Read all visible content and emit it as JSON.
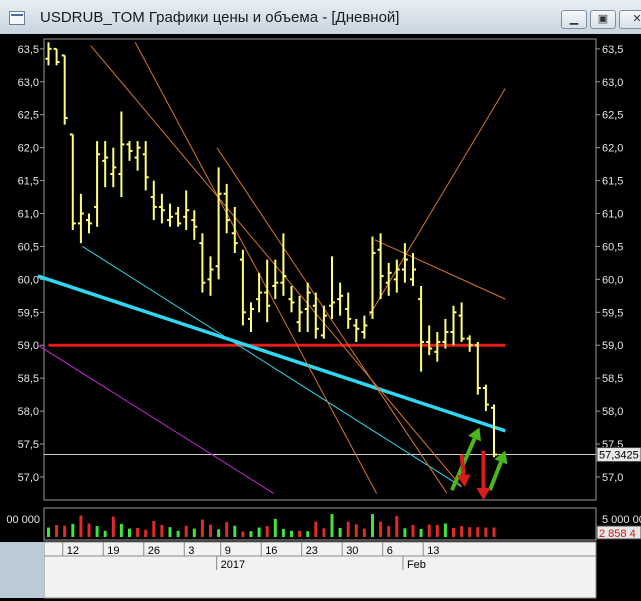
{
  "window": {
    "title": "USDRUB_TOM Графики цены и объема - [Дневной]",
    "buttons": [
      "minimize",
      "restore",
      "close"
    ]
  },
  "chart_data": {
    "type": "ohlc",
    "instrument": "USDRUB_TOM",
    "ylim": [
      56.65,
      63.65
    ],
    "y_ticks": [
      "63,5",
      "63,0",
      "62,5",
      "62,0",
      "61,5",
      "61,0",
      "60,5",
      "60,0",
      "59,5",
      "59,0",
      "58,5",
      "58,0",
      "57,5",
      "57,0"
    ],
    "y_tick_values": [
      63.5,
      63.0,
      62.5,
      62.0,
      61.5,
      61.0,
      60.5,
      60.0,
      59.5,
      59.0,
      58.5,
      58.0,
      57.5,
      57.0
    ],
    "last_price_label": "57,3425",
    "last_price": 57.34,
    "x_tick_labels": [
      "12",
      "19",
      "26",
      "3",
      "9",
      "16",
      "23",
      "30",
      "6",
      "13"
    ],
    "period_labels": [
      "2017",
      "Feb"
    ],
    "volume_tick_labels": [
      "00 000",
      "5 000 000"
    ],
    "volume_last_label": "2 858 4",
    "volume_max": 6600000,
    "ohlc": [
      [
        63.35,
        63.6,
        63.25,
        63.5
      ],
      [
        63.5,
        63.5,
        63.25,
        63.3
      ],
      [
        63.4,
        63.4,
        62.35,
        62.45
      ],
      [
        62.2,
        62.2,
        60.75,
        60.85
      ],
      [
        60.85,
        61.3,
        60.55,
        61.0
      ],
      [
        60.9,
        61.0,
        60.7,
        60.85
      ],
      [
        61.1,
        62.1,
        60.8,
        61.9
      ],
      [
        61.8,
        62.1,
        61.4,
        61.85
      ],
      [
        61.6,
        62.0,
        61.4,
        61.7
      ],
      [
        61.6,
        62.55,
        61.25,
        62.05
      ],
      [
        62.05,
        62.1,
        61.8,
        61.95
      ],
      [
        61.85,
        62.1,
        61.65,
        62.0
      ],
      [
        61.9,
        62.1,
        61.35,
        61.55
      ],
      [
        61.25,
        61.5,
        60.9,
        61.1
      ],
      [
        61.1,
        61.3,
        60.85,
        61.05
      ],
      [
        60.9,
        61.15,
        60.8,
        60.95
      ],
      [
        61.0,
        61.1,
        60.8,
        60.85
      ],
      [
        60.95,
        61.35,
        60.75,
        61.05
      ],
      [
        60.9,
        61.05,
        60.6,
        60.8
      ],
      [
        60.55,
        60.7,
        59.8,
        59.95
      ],
      [
        60.0,
        60.35,
        59.75,
        60.15
      ],
      [
        60.2,
        61.7,
        60.0,
        61.3
      ],
      [
        61.3,
        61.45,
        60.7,
        60.9
      ],
      [
        60.7,
        61.1,
        60.4,
        60.55
      ],
      [
        60.3,
        60.45,
        59.3,
        59.5
      ],
      [
        59.4,
        59.65,
        59.2,
        59.55
      ],
      [
        59.7,
        60.1,
        59.5,
        59.8
      ],
      [
        59.8,
        60.3,
        59.35,
        59.6
      ],
      [
        59.9,
        60.3,
        59.7,
        59.95
      ],
      [
        59.95,
        60.7,
        59.75,
        60.05
      ],
      [
        59.7,
        59.9,
        59.5,
        59.65
      ],
      [
        59.35,
        59.75,
        59.2,
        59.5
      ],
      [
        59.55,
        59.95,
        59.2,
        59.8
      ],
      [
        59.6,
        59.8,
        59.1,
        59.25
      ],
      [
        59.15,
        59.6,
        59.1,
        59.45
      ],
      [
        59.6,
        60.35,
        59.4,
        59.65
      ],
      [
        59.7,
        59.95,
        59.45,
        59.75
      ],
      [
        59.55,
        59.8,
        59.25,
        59.4
      ],
      [
        59.3,
        59.4,
        59.05,
        59.25
      ],
      [
        59.2,
        59.45,
        59.1,
        59.3
      ],
      [
        59.5,
        60.65,
        59.4,
        60.4
      ],
      [
        60.45,
        60.7,
        59.7,
        60.05
      ],
      [
        59.95,
        60.25,
        59.75,
        60.1
      ],
      [
        60.0,
        60.3,
        59.8,
        60.15
      ],
      [
        60.15,
        60.55,
        59.95,
        60.3
      ],
      [
        60.0,
        60.4,
        59.9,
        60.15
      ],
      [
        59.7,
        59.9,
        58.6,
        59.05
      ],
      [
        59.05,
        59.3,
        58.85,
        58.95
      ],
      [
        58.9,
        59.2,
        58.75,
        59.05
      ],
      [
        59.05,
        59.4,
        58.95,
        59.2
      ],
      [
        59.2,
        59.6,
        59.0,
        59.5
      ],
      [
        59.45,
        59.65,
        59.05,
        59.1
      ],
      [
        59.1,
        59.15,
        58.9,
        59.0
      ],
      [
        59.0,
        59.05,
        58.25,
        58.35
      ],
      [
        58.35,
        58.4,
        58.0,
        58.1
      ],
      [
        58.05,
        58.1,
        57.3,
        57.34
      ]
    ],
    "volume": [
      2600000,
      3300000,
      3100000,
      3600000,
      5900000,
      3700000,
      3000000,
      1700000,
      5600000,
      3600000,
      2300000,
      2500000,
      2000000,
      4400000,
      3300000,
      2700000,
      1700000,
      3100000,
      2300000,
      4800000,
      3400000,
      2100000,
      4100000,
      3100000,
      1500000,
      1600000,
      2600000,
      3000000,
      5000000,
      2200000,
      1700000,
      1700000,
      1600000,
      4200000,
      2400000,
      6300000,
      2500000,
      4200000,
      3500000,
      2300000,
      6300000,
      4200000,
      3000000,
      5800000,
      2400000,
      3300000,
      2200000,
      3400000,
      3300000,
      3700000,
      2500000,
      3000000,
      2700000,
      2700000,
      2600000,
      2600000
    ],
    "volume_up": [
      true,
      false,
      false,
      true,
      false,
      false,
      true,
      true,
      false,
      true,
      true,
      false,
      false,
      false,
      false,
      true,
      true,
      false,
      true,
      false,
      false,
      true,
      false,
      true,
      false,
      true,
      true,
      false,
      true,
      true,
      true,
      false,
      true,
      false,
      false,
      true,
      true,
      false,
      false,
      false,
      true,
      false,
      false,
      false,
      true,
      false,
      true,
      false,
      false,
      true,
      false,
      false,
      false,
      false,
      false,
      false
    ],
    "lines": [
      {
        "label": "support",
        "color": "#e41c1c",
        "from": [
          0,
          59.0
        ],
        "to": [
          56.4,
          59.0
        ]
      },
      {
        "label": "trend",
        "color": "#2fd8f0",
        "from": [
          -1.3,
          60.05
        ],
        "to": [
          56.4,
          57.7
        ]
      },
      {
        "label": "channel-lower",
        "color": "#2fd8f0",
        "from": [
          4.2,
          60.5
        ],
        "to": [
          51.0,
          56.85
        ]
      },
      {
        "label": "fan-1",
        "color": "#d4762c",
        "from": [
          5.2,
          63.55
        ],
        "to": [
          51.0,
          56.85
        ]
      },
      {
        "label": "fan-2",
        "color": "#d4762c",
        "from": [
          10.7,
          63.6
        ],
        "to": [
          40.5,
          56.75
        ]
      },
      {
        "label": "fan-3",
        "color": "#d4762c",
        "from": [
          20.8,
          62.0
        ],
        "to": [
          49.2,
          56.75
        ]
      },
      {
        "label": "rise",
        "color": "#d4762c",
        "from": [
          39.6,
          59.45
        ],
        "to": [
          56.4,
          62.9
        ]
      },
      {
        "label": "upper-channel",
        "color": "#d4762c",
        "from": [
          40.3,
          60.6
        ],
        "to": [
          56.4,
          59.7
        ]
      },
      {
        "label": "magenta",
        "color": "#c82ad8",
        "from": [
          -1.3,
          59.0
        ],
        "to": [
          27.8,
          56.75
        ]
      }
    ],
    "arrows": [
      {
        "color": "#4ab81c",
        "from": [
          49.8,
          56.8
        ],
        "to": [
          53.2,
          57.75
        ]
      },
      {
        "color": "#4ab81c",
        "from": [
          54.5,
          56.8
        ],
        "to": [
          56.4,
          57.4
        ]
      },
      {
        "color": "#d81c1c",
        "from": [
          53.7,
          57.4
        ],
        "to": [
          53.7,
          56.65
        ]
      },
      {
        "color": "#d81c1c",
        "from": [
          51.0,
          57.34
        ],
        "to": [
          51.4,
          56.85
        ]
      }
    ],
    "grid": false
  }
}
